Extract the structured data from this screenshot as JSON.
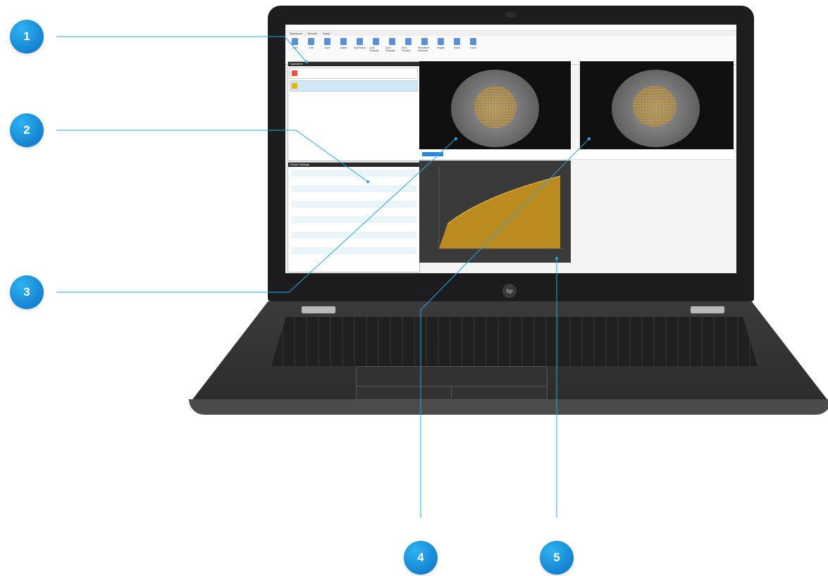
{
  "callouts": [
    {
      "number": "1"
    },
    {
      "number": "2"
    },
    {
      "number": "3"
    },
    {
      "number": "4"
    },
    {
      "number": "5"
    }
  ],
  "colors": {
    "callout": "#1f8fdc",
    "leader_line": "#29a7e1",
    "chart_fill": "#d49a1c",
    "specimen_swatch_1": "#e8543b",
    "specimen_swatch_2": "#e4b21a"
  },
  "laptop": {
    "logo": "hp"
  },
  "app": {
    "menu": [
      "Specimen",
      "Results",
      "Setup"
    ],
    "ribbon": [
      "Add",
      "Edit",
      "Save",
      "Adjust",
      "Add Result",
      "Load Template",
      "Save Template",
      "Print Preview",
      "Worksheet Standard",
      "Images",
      "Video",
      "Excel"
    ],
    "panes": {
      "specimen_title": "Specimen",
      "results_title": "Result Settings"
    }
  }
}
